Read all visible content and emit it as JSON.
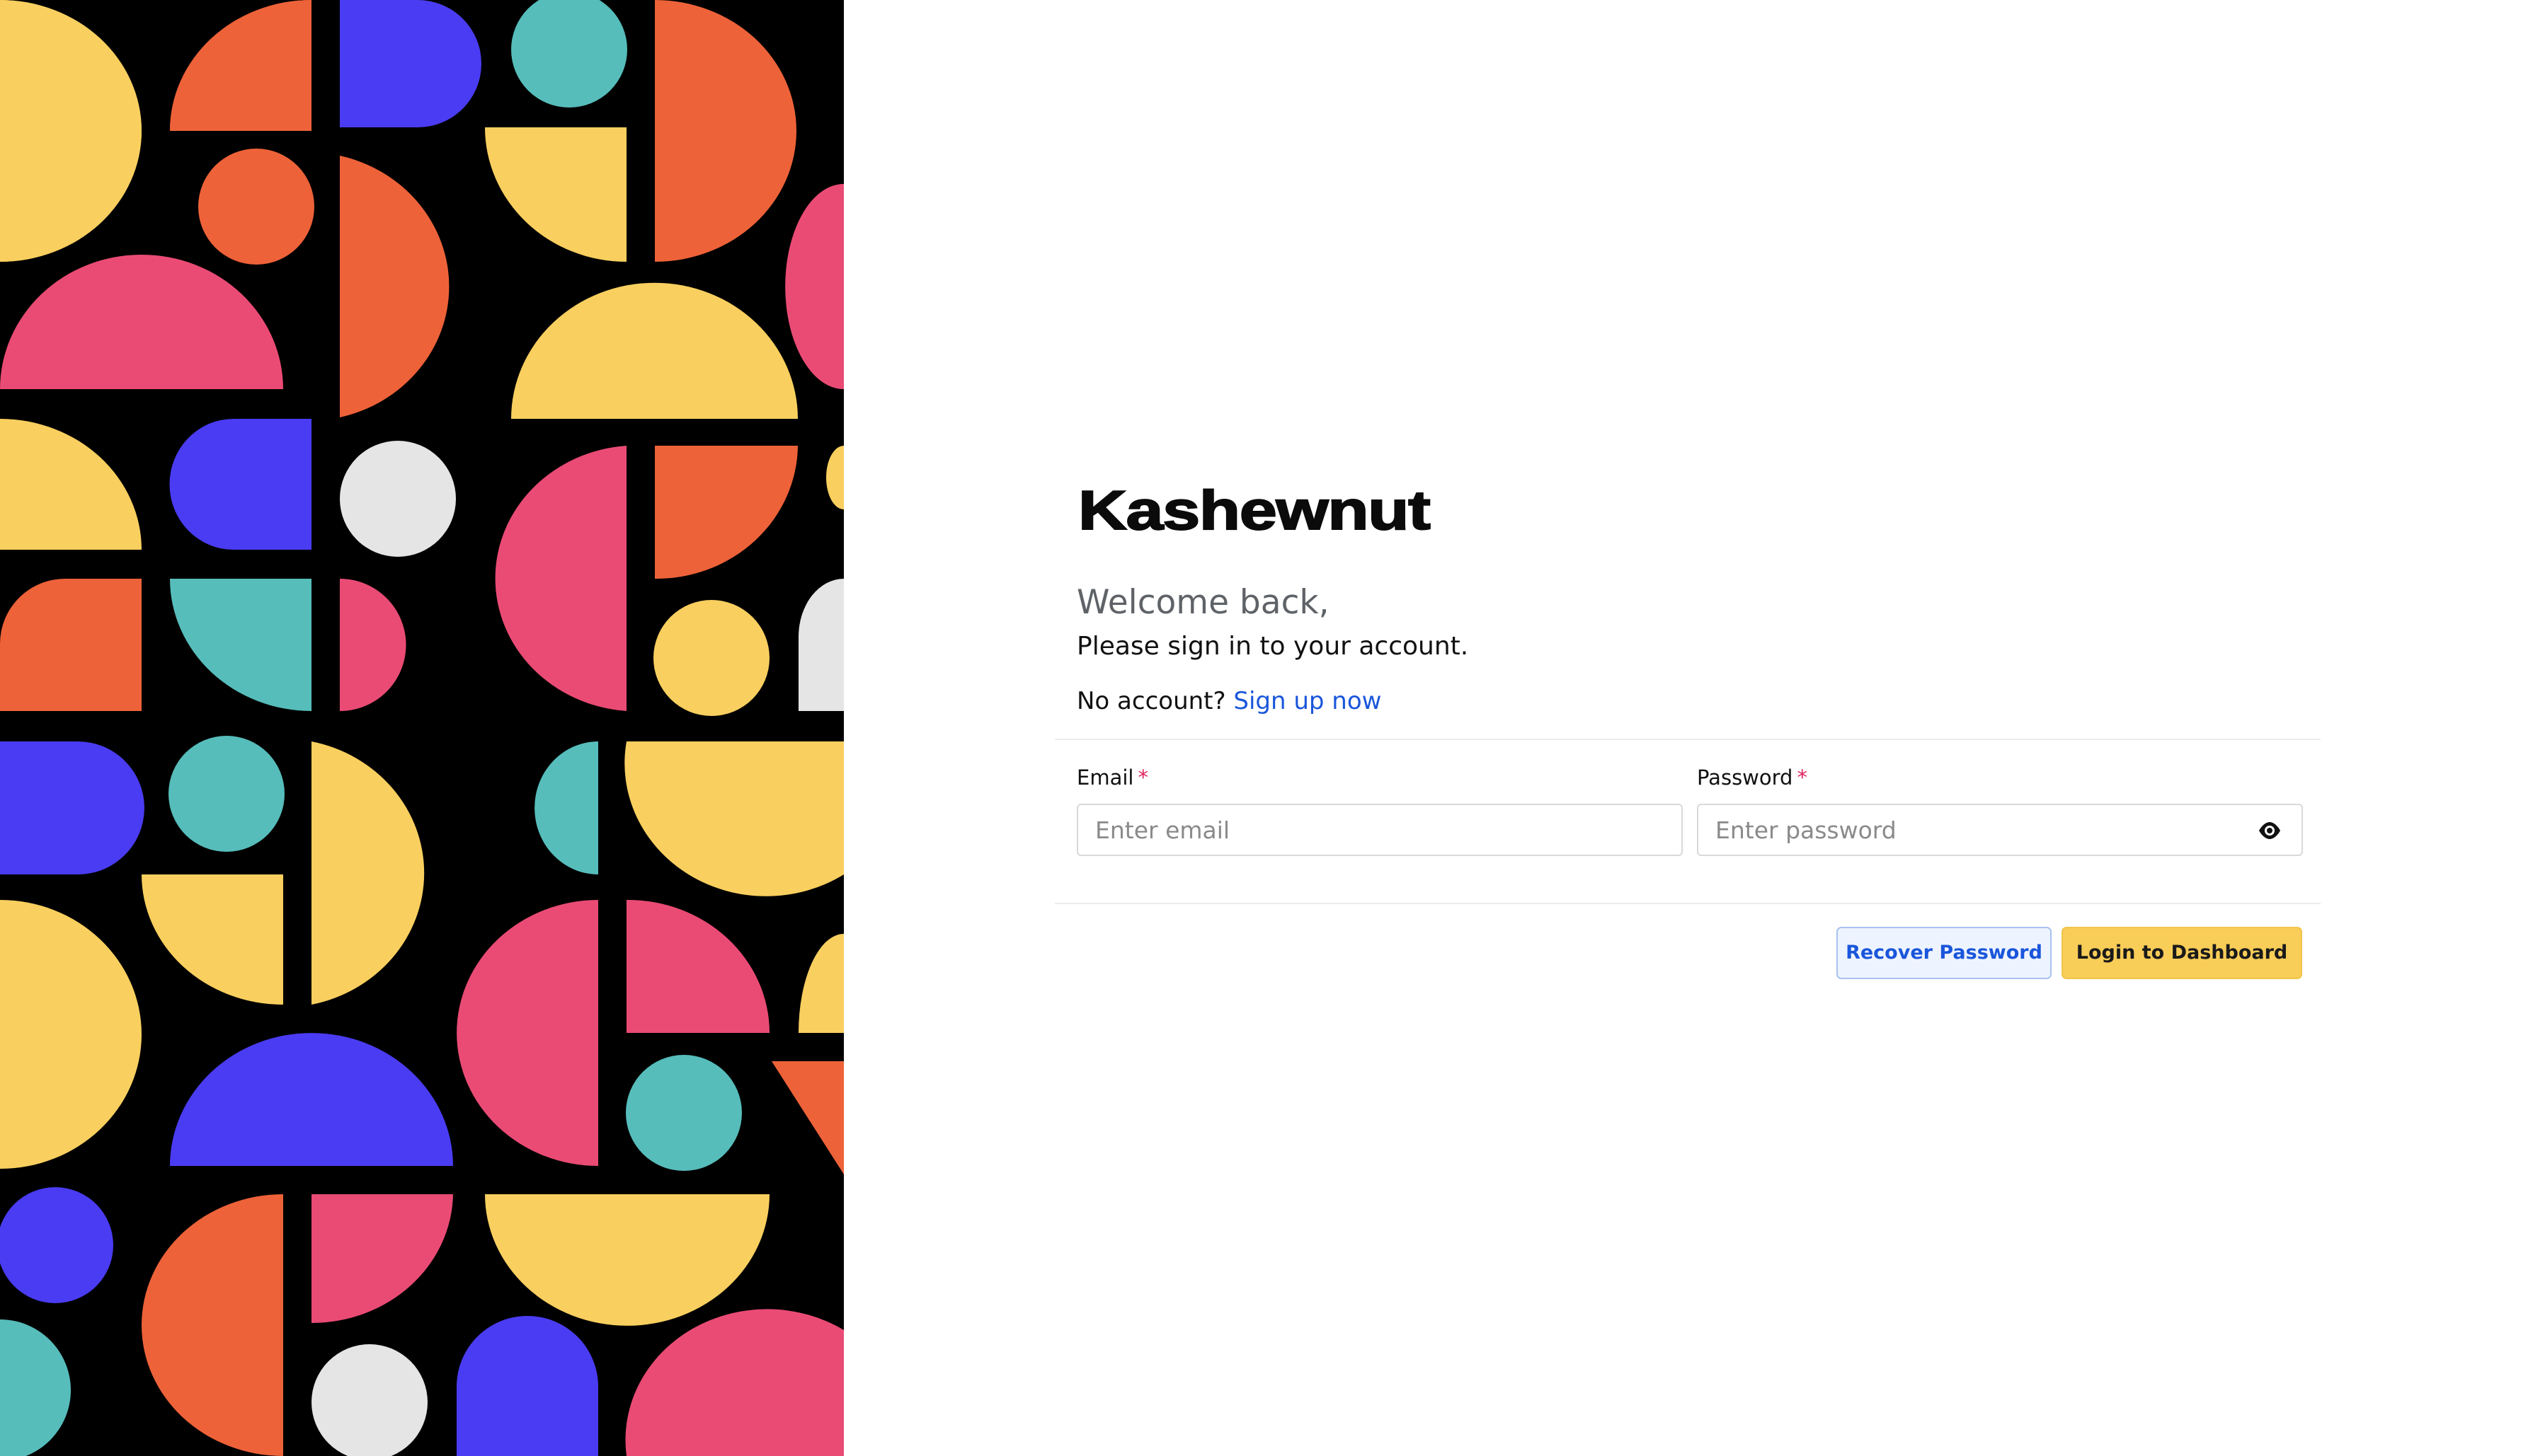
{
  "brand": {
    "logo_text": "Kashewnut"
  },
  "heading": {
    "welcome": "Welcome back,",
    "subtitle": "Please sign in to your account."
  },
  "signup": {
    "prompt": "No account?",
    "link_label": "Sign up now"
  },
  "form": {
    "email": {
      "label": "Email",
      "required_mark": "*",
      "placeholder": "Enter email",
      "value": ""
    },
    "password": {
      "label": "Password",
      "required_mark": "*",
      "placeholder": "Enter password",
      "value": "",
      "toggle_icon": "eye-icon"
    }
  },
  "actions": {
    "recover_label": "Recover Password",
    "login_label": "Login to Dashboard"
  },
  "colors": {
    "accent_link": "#1a56db",
    "primary_button": "#f8cd58",
    "required_mark": "#e0245e",
    "pattern_background": "#000000",
    "pattern_yellow": "#f9cf5f",
    "pattern_orange": "#ee6239",
    "pattern_blue": "#4a3cf2",
    "pattern_teal": "#56bdbb",
    "pattern_pink": "#ea4b75",
    "pattern_grey": "#e5e5e5"
  }
}
